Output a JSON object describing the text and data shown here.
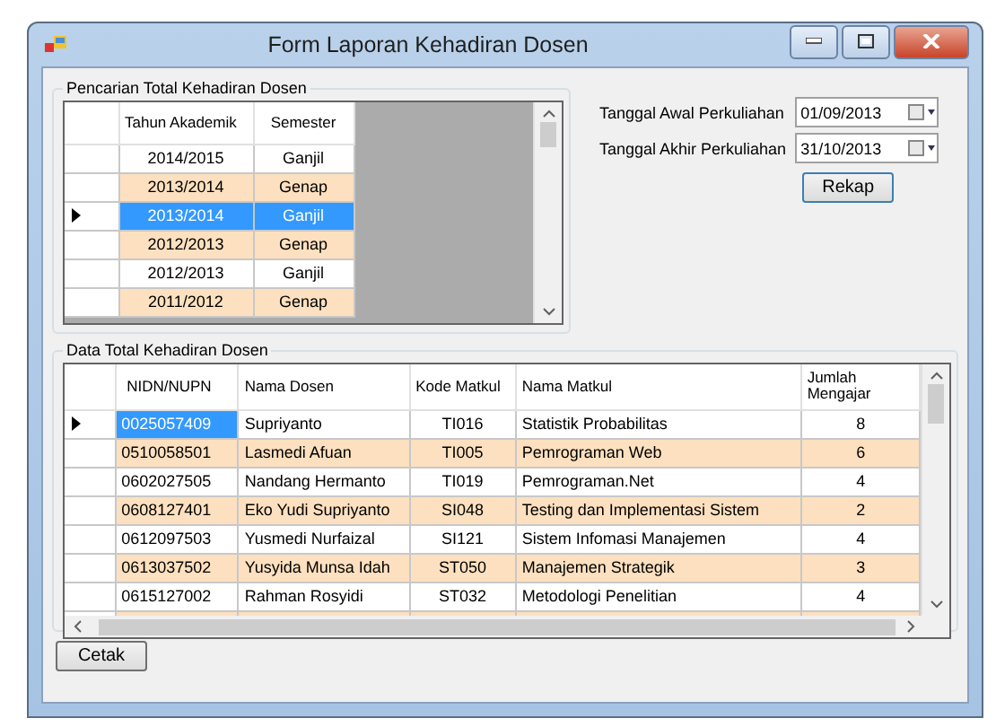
{
  "window": {
    "title": "Form Laporan Kehadiran Dosen"
  },
  "search_group": {
    "title": "Pencarian Total Kehadiran Dosen",
    "columns": [
      "Tahun Akademik",
      "Semester"
    ],
    "rows": [
      {
        "tahun": "2014/2015",
        "semester": "Ganjil",
        "selected": false,
        "current": false
      },
      {
        "tahun": "2013/2014",
        "semester": "Genap",
        "selected": false,
        "current": false
      },
      {
        "tahun": "2013/2014",
        "semester": "Ganjil",
        "selected": true,
        "current": true
      },
      {
        "tahun": "2012/2013",
        "semester": "Genap",
        "selected": false,
        "current": false
      },
      {
        "tahun": "2012/2013",
        "semester": "Ganjil",
        "selected": false,
        "current": false
      },
      {
        "tahun": "2011/2012",
        "semester": "Genap",
        "selected": false,
        "current": false
      }
    ]
  },
  "date_fields": [
    {
      "label": "Tanggal Awal Perkuliahan",
      "value": "01/09/2013"
    },
    {
      "label": "Tanggal Akhir Perkuliahan",
      "value": "31/10/2013"
    }
  ],
  "rekap_button": "Rekap",
  "data_group": {
    "title": "Data Total Kehadiran Dosen",
    "columns": [
      "NIDN/NUPN",
      "Nama Dosen",
      "Kode Matkul",
      "Nama Matkul",
      "Jumlah Mengajar"
    ],
    "rows": [
      {
        "cells": [
          "0025057409",
          "Supriyanto",
          "TI016",
          "Statistik Probabilitas",
          "8"
        ],
        "current": true
      },
      {
        "cells": [
          "0510058501",
          "Lasmedi Afuan",
          "TI005",
          "Pemrograman Web",
          "6"
        ],
        "current": false
      },
      {
        "cells": [
          "0602027505",
          "Nandang Hermanto",
          "TI019",
          "Pemrograman.Net",
          "4"
        ],
        "current": false
      },
      {
        "cells": [
          "0608127401",
          "Eko Yudi Supriyanto",
          "SI048",
          "Testing dan Implementasi Sistem",
          "2"
        ],
        "current": false
      },
      {
        "cells": [
          "0612097503",
          "Yusmedi Nurfaizal",
          "SI121",
          "Sistem Infomasi Manajemen",
          "4"
        ],
        "current": false
      },
      {
        "cells": [
          "0613037502",
          "Yusyida Munsa Idah",
          "ST050",
          "Manajemen Strategik",
          "3"
        ],
        "current": false
      },
      {
        "cells": [
          "0615127002",
          "Rahman Rosyidi",
          "ST032",
          "Metodologi Penelitian",
          "4"
        ],
        "current": false
      }
    ]
  },
  "print_button": "Cetak"
}
